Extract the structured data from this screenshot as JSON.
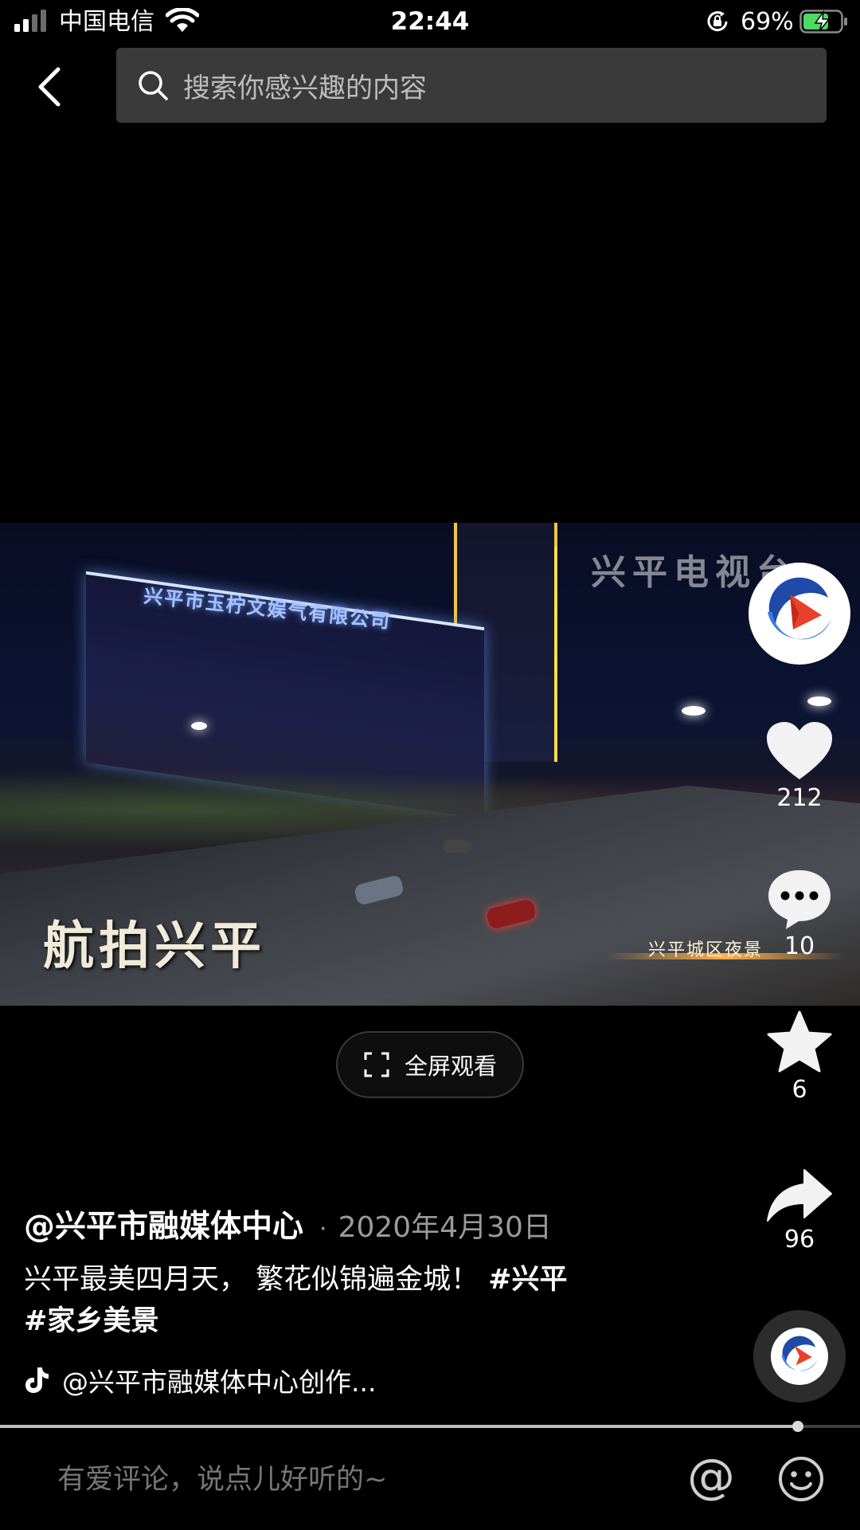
{
  "status_bar": {
    "carrier": "中国电信",
    "time": "22:44",
    "battery_percent": "69%",
    "battery_level": 0.69,
    "icons": [
      "signal-icon",
      "wifi-icon",
      "rotation-lock-icon",
      "battery-charging-icon"
    ]
  },
  "nav": {
    "back_icon": "chevron-left-icon",
    "search_placeholder": "搜索你感兴趣的内容",
    "search_icon": "search-icon"
  },
  "video": {
    "watermark": "兴平电视台",
    "caption": "航拍兴平",
    "subcaption": "兴平城区夜景",
    "building_sign": "兴平市玉柠文娱气有限公司"
  },
  "fullscreen": {
    "label": "全屏观看",
    "icon": "fullscreen-icon"
  },
  "actions": {
    "like": {
      "icon": "heart-icon",
      "count": "212"
    },
    "comment": {
      "icon": "comment-bubble-icon",
      "count": "10"
    },
    "favorite": {
      "icon": "star-icon",
      "count": "6"
    },
    "share": {
      "icon": "share-arrow-icon",
      "count": "96"
    }
  },
  "post": {
    "author": "@兴平市融媒体中心",
    "separator": "·",
    "date": "2020年4月30日",
    "description": "兴平最美四月天， 繁花似锦遍金城！",
    "hashtags": [
      "#兴平",
      "#家乡美景"
    ],
    "music": "@兴平市融媒体中心创作..."
  },
  "progress": {
    "fraction": 0.928
  },
  "comment_bar": {
    "placeholder": "有爱评论，说点儿好听的~",
    "at_label": "@",
    "emoji_icon": "smiley-icon"
  },
  "colors": {
    "background": "#000000",
    "search_bg": "#3a3a3a",
    "muted_text": "#9a9a9a",
    "placeholder_text": "#767676",
    "battery_green": "#4cd964",
    "logo_blue": "#1f4aa8",
    "logo_red": "#e8402a"
  }
}
